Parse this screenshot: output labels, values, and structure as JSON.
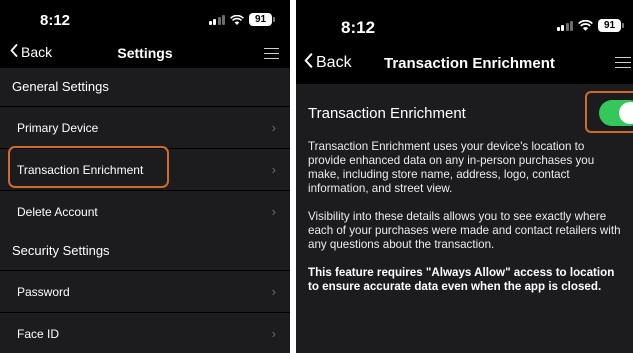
{
  "left": {
    "status": {
      "time": "8:12",
      "battery": "91"
    },
    "nav": {
      "back_label": "Back",
      "title": "Settings"
    },
    "sections": {
      "general": "General Settings",
      "security": "Security Settings"
    },
    "rows": {
      "primary_device": "Primary Device",
      "transaction_enrichment": "Transaction Enrichment",
      "delete_account": "Delete Account",
      "password": "Password",
      "face_id": "Face ID"
    },
    "chevron": "›"
  },
  "right": {
    "status": {
      "time": "8:12",
      "battery": "91"
    },
    "nav": {
      "back_label": "Back",
      "title": "Transaction Enrichment"
    },
    "toggle": {
      "label": "Transaction Enrichment",
      "on": true,
      "color": "#34c759"
    },
    "paragraphs": {
      "p1": "Transaction Enrichment uses your device's location to provide enhanced data on any in-person purchases you make, including store name, address, logo, contact information, and street view.",
      "p2": "Visibility into these details allows you to see exactly where each of your purchases were made and contact retailers with any questions about the transaction.",
      "p3": "This feature requires \"Always Allow\" access to location to ensure accurate data even when the app is closed."
    }
  },
  "colors": {
    "highlight": "#d06b2d",
    "background": "#000000",
    "surface": "#1c1c1e"
  }
}
